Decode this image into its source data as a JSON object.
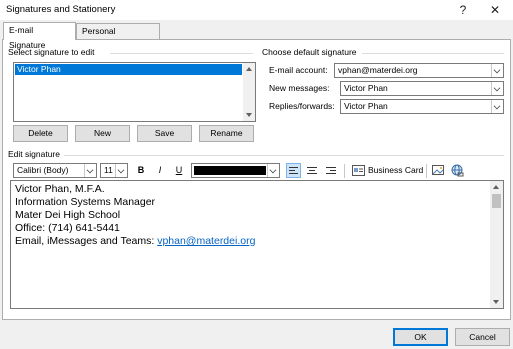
{
  "window": {
    "title": "Signatures and Stationery",
    "help_glyph": "?",
    "close_glyph": "✕"
  },
  "tabs": [
    {
      "label": "E-mail Signature",
      "active": true
    },
    {
      "label": "Personal Stationery",
      "active": false
    }
  ],
  "select_signature": {
    "label": "Select signature to edit",
    "items": [
      "Victor Phan"
    ],
    "selected_index": 0
  },
  "signature_buttons": {
    "delete": "Delete",
    "new": "New",
    "save": "Save",
    "rename": "Rename"
  },
  "default_signature": {
    "label": "Choose default signature",
    "email_account_label": "E-mail account:",
    "email_account_value": "vphan@materdei.org",
    "new_messages_label": "New messages:",
    "new_messages_value": "Victor Phan",
    "replies_label": "Replies/forwards:",
    "replies_value": "Victor Phan"
  },
  "edit_signature": {
    "label": "Edit signature",
    "font_value": "Calibri (Body)",
    "size_value": "11",
    "bold": "B",
    "italic": "I",
    "underline": "U",
    "font_color": "#000000",
    "business_card_label": "Business Card",
    "lines": [
      "Victor Phan, M.F.A.",
      "Information Systems Manager",
      "Mater Dei High School",
      "Office: (714) 641-5441"
    ],
    "last_line_prefix": "Email, iMessages and Teams: ",
    "last_line_link": "vphan@materdei.org"
  },
  "footer": {
    "ok": "OK",
    "cancel": "Cancel"
  },
  "colors": {
    "selection": "#0078d7",
    "link": "#0563c1",
    "window_bg": "#f0f0f0"
  }
}
